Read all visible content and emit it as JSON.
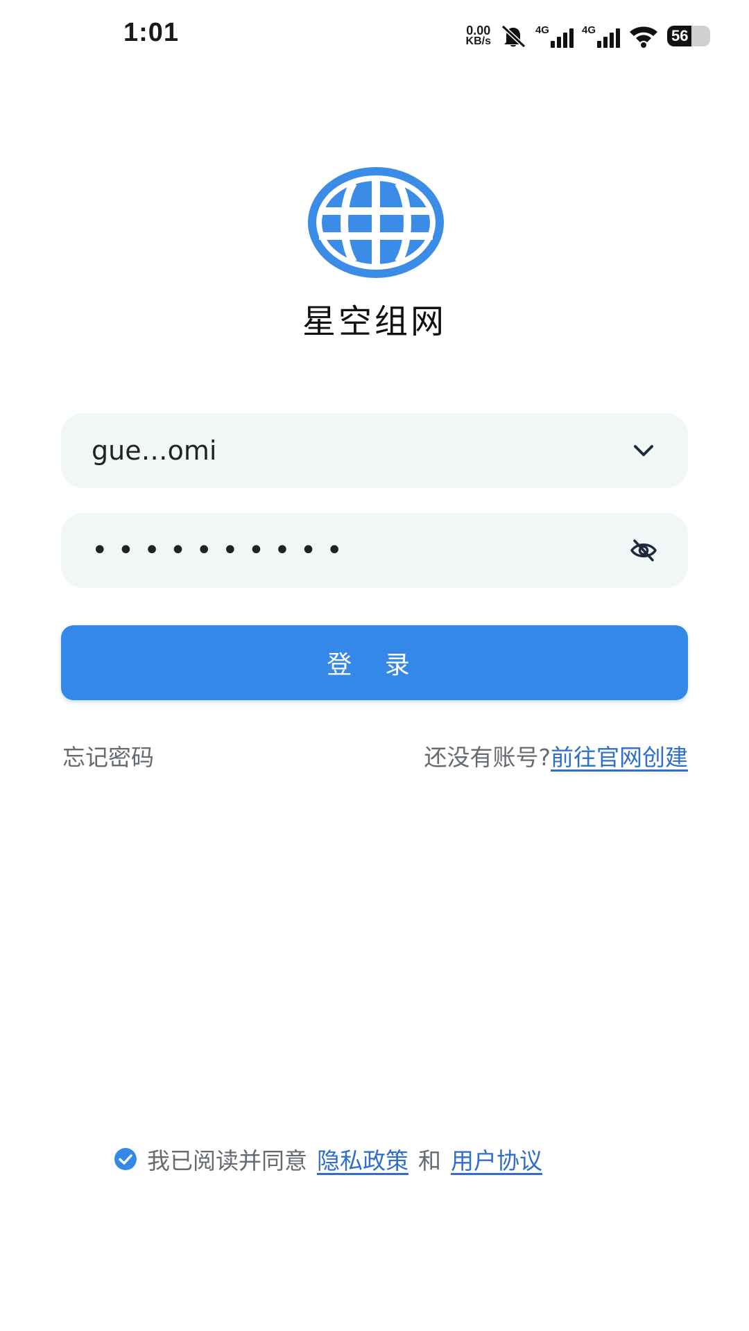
{
  "status_bar": {
    "time": "1:01",
    "net_speed_value": "0.00",
    "net_speed_unit": "KB/s",
    "signal1_label": "4G",
    "signal2_label": "4G",
    "battery_level": "56"
  },
  "app": {
    "name": "星空组网",
    "logo_icon": "globe-icon",
    "brand_color": "#3489e8"
  },
  "login_form": {
    "username_value": "gue…omi",
    "username_icon": "chevron-down-icon",
    "password_value": "••••••••••",
    "password_icon": "eye-off-icon",
    "login_label": "登 录"
  },
  "links": {
    "forgot_password": "忘记密码",
    "no_account": "还没有账号?",
    "create_account": "前往官网创建"
  },
  "agreement": {
    "checkbox_icon": "check-circle-icon",
    "prefix": "我已阅读并同意",
    "privacy_policy": "隐私政策",
    "and": "和",
    "user_agreement": "用户协议"
  }
}
